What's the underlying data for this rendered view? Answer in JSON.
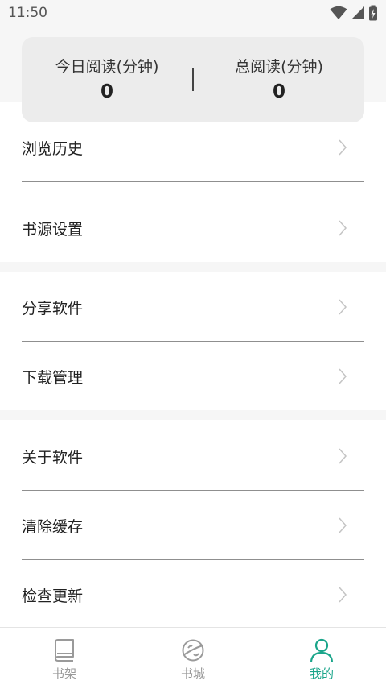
{
  "status_bar": {
    "time": "11:50"
  },
  "stats": {
    "today_label": "今日阅读(分钟)",
    "today_value": "0",
    "total_label": "总阅读(分钟)",
    "total_value": "0"
  },
  "menu": {
    "browse_history": "浏览历史",
    "source_settings": "书源设置",
    "share_app": "分享软件",
    "download_manager": "下载管理",
    "about_app": "关于软件",
    "clear_cache": "清除缓存",
    "check_update": "检查更新"
  },
  "tab_bar": {
    "bookshelf": "书架",
    "bookstore": "书城",
    "mine": "我的",
    "active_color": "#1aa58a",
    "inactive_color": "#9a9a9a"
  }
}
